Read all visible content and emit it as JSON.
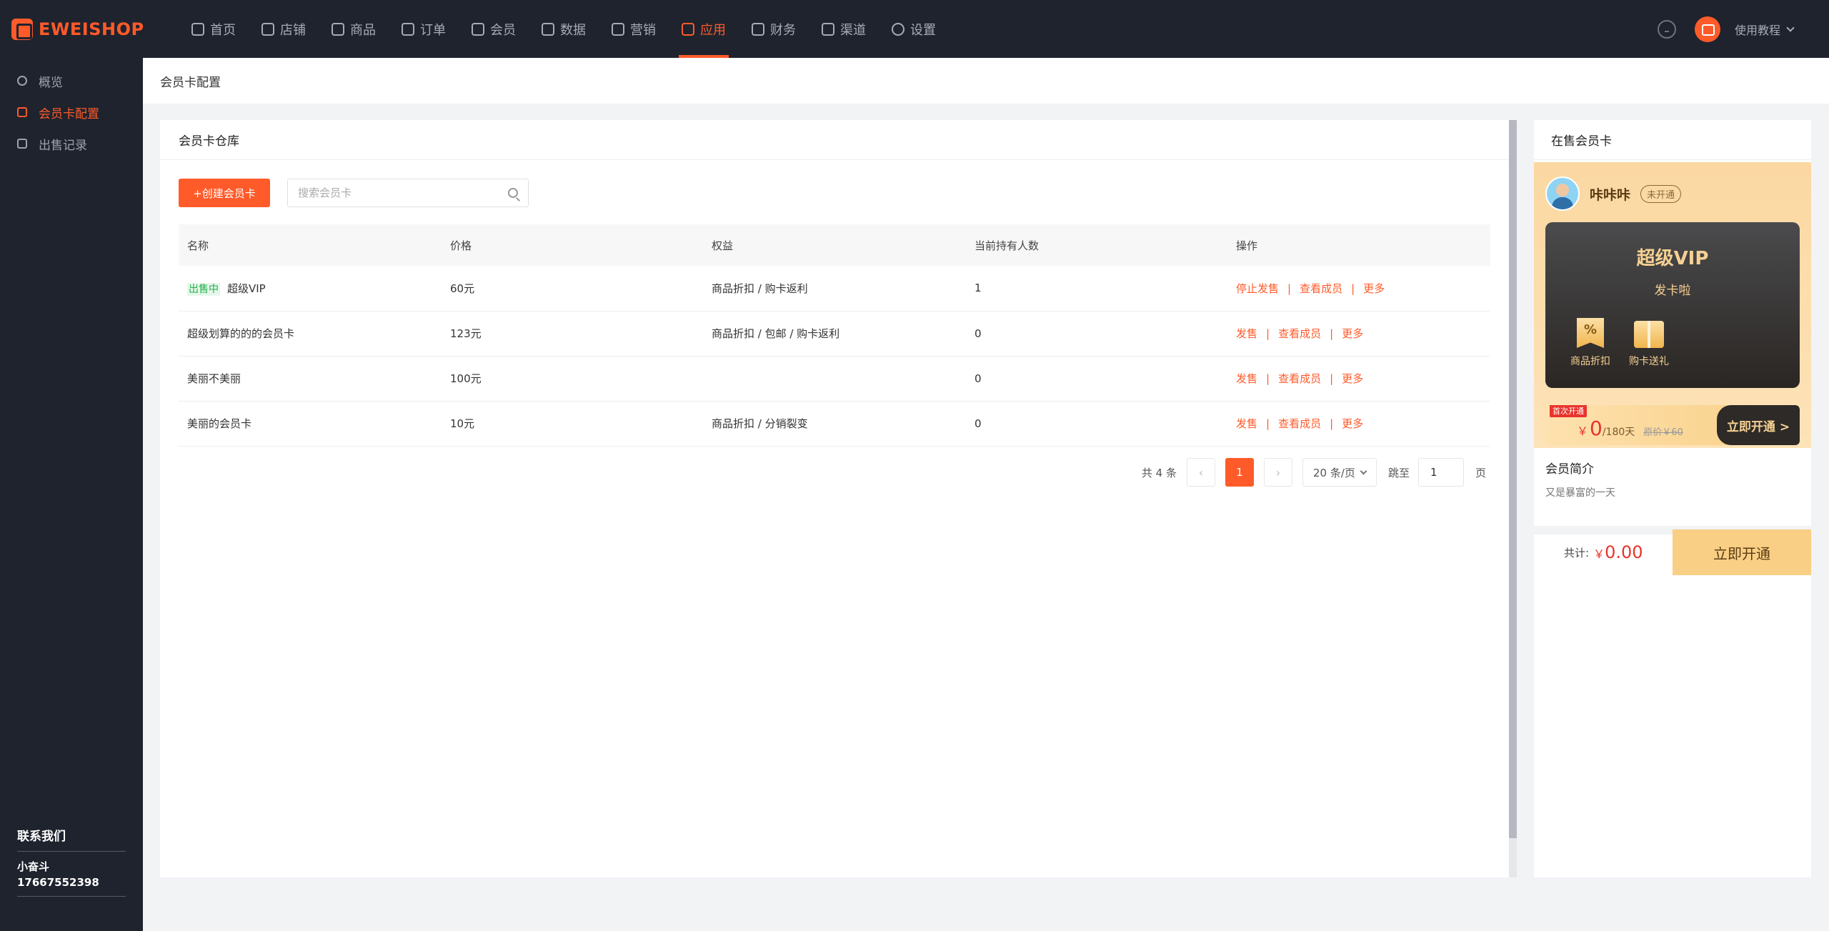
{
  "brand": {
    "name": "EWEISHOP",
    "accent": "#ff5a29"
  },
  "nav": [
    {
      "label": "首页",
      "icon": "home-icon"
    },
    {
      "label": "店铺",
      "icon": "store-icon"
    },
    {
      "label": "商品",
      "icon": "goods-icon"
    },
    {
      "label": "订单",
      "icon": "order-icon"
    },
    {
      "label": "会员",
      "icon": "user-icon"
    },
    {
      "label": "数据",
      "icon": "chart-icon"
    },
    {
      "label": "营销",
      "icon": "tag-icon"
    },
    {
      "label": "应用",
      "icon": "app-icon",
      "active": true
    },
    {
      "label": "财务",
      "icon": "finance-icon"
    },
    {
      "label": "渠道",
      "icon": "channel-icon"
    },
    {
      "label": "设置",
      "icon": "gear-icon"
    }
  ],
  "top_right": {
    "tutorial": "使用教程"
  },
  "sidebar": {
    "items": [
      {
        "label": "概览"
      },
      {
        "label": "会员卡配置",
        "active": true
      },
      {
        "label": "出售记录"
      }
    ],
    "contact": {
      "title": "联系我们",
      "name": "小奋斗",
      "phone": "17667552398"
    }
  },
  "breadcrumb": "会员卡配置",
  "panel": {
    "title": "会员卡仓库",
    "create_label": "+创建会员卡",
    "search_placeholder": "搜索会员卡",
    "columns": [
      "名称",
      "价格",
      "权益",
      "当前持有人数",
      "操作"
    ],
    "rows": [
      {
        "tag": "出售中",
        "name": "超级VIP",
        "price": "60元",
        "rights": "商品折扣 / 购卡返利",
        "count": "1",
        "ops": [
          "停止发售",
          "查看成员",
          "更多"
        ]
      },
      {
        "tag": "",
        "name": "超级划算的的的会员卡",
        "price": "123元",
        "rights": "商品折扣 / 包邮 / 购卡返利",
        "count": "0",
        "ops": [
          "发售",
          "查看成员",
          "更多"
        ]
      },
      {
        "tag": "",
        "name": "美丽不美丽",
        "price": "100元",
        "rights": "",
        "count": "0",
        "ops": [
          "发售",
          "查看成员",
          "更多"
        ]
      },
      {
        "tag": "",
        "name": "美丽的会员卡",
        "price": "10元",
        "rights": "商品折扣 / 分销裂变",
        "count": "0",
        "ops": [
          "发售",
          "查看成员",
          "更多"
        ]
      }
    ],
    "pager": {
      "total": "共 4 条",
      "current": "1",
      "size": "20 条/页",
      "jump": "跳至",
      "jump_value": "1",
      "page": "页"
    }
  },
  "preview": {
    "title": "在售会员卡",
    "user_name": "咔咔咔",
    "status": "未开通",
    "card_title": "超级VIP",
    "card_sub": "发卡啦",
    "benefits": [
      "商品折扣",
      "购卡送礼"
    ],
    "first_tag": "首次开通",
    "price_sym": "￥",
    "price": "0",
    "price_unit": "/180天",
    "orig_price": "原价￥60",
    "open_label": "立即开通 >",
    "intro_title": "会员简介",
    "intro_text": "又是暴富的一天",
    "total_label": "共计:",
    "total_sym": "￥",
    "total_value": "0.00",
    "total_button": "立即开通"
  }
}
